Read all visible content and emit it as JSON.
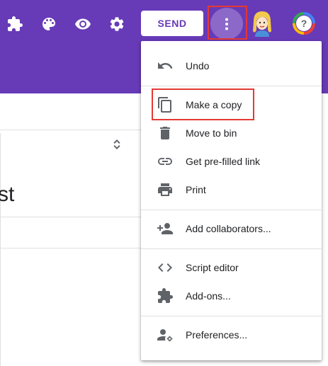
{
  "toolbar": {
    "icons": [
      "addon-puzzle-icon",
      "palette-icon",
      "preview-eye-icon",
      "settings-gear-icon"
    ],
    "send_label": "SEND",
    "more_icon": "more-vert-icon",
    "avatar_icon": "user-avatar",
    "help_label": "?"
  },
  "menu": {
    "items": [
      {
        "icon": "undo-icon",
        "label": "Undo"
      },
      {
        "icon": "copy-icon",
        "label": "Make a copy"
      },
      {
        "icon": "trash-icon",
        "label": "Move to bin"
      },
      {
        "icon": "link-icon",
        "label": "Get pre-filled link"
      },
      {
        "icon": "print-icon",
        "label": "Print"
      },
      {
        "icon": "add-people-icon",
        "label": "Add collaborators..."
      },
      {
        "icon": "code-icon",
        "label": "Script editor"
      },
      {
        "icon": "puzzle-icon",
        "label": "Add-ons..."
      },
      {
        "icon": "person-settings-icon",
        "label": "Preferences..."
      }
    ]
  },
  "document": {
    "title_fragment": "st"
  },
  "colors": {
    "brand_purple": "#673ab7",
    "highlight_red": "#e53935",
    "icon_gray": "#5f6368"
  }
}
